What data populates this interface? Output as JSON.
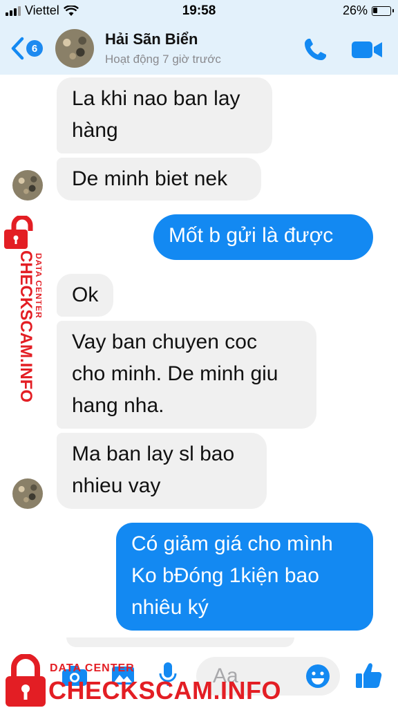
{
  "status_bar": {
    "carrier": "Viettel",
    "time": "19:58",
    "battery": "26%",
    "battery_level": 0.26
  },
  "header": {
    "unread_count": "6",
    "contact_name": "Hải Sãn Biển",
    "contact_status": "Hoạt động 7 giờ trước"
  },
  "messages": [
    {
      "from": "contact",
      "text_lines": [
        "La khi nao ban lay",
        "hàng"
      ]
    },
    {
      "from": "contact",
      "text_lines": [
        "De minh biet nek"
      ]
    },
    {
      "from": "me",
      "text_lines": [
        "Mốt b gửi là  được"
      ]
    },
    {
      "from": "contact",
      "text_lines": [
        "Ok"
      ]
    },
    {
      "from": "contact",
      "text_lines": [
        "Vay ban chuyen coc",
        "cho minh. De minh giu",
        "hang nha."
      ]
    },
    {
      "from": "contact",
      "text_lines": [
        "Ma ban lay sl bao",
        "nhieu vay"
      ]
    },
    {
      "from": "me",
      "text_lines": [
        "Có giảm giá cho mình",
        "Ko bĐóng 1kiện bao",
        "nhiêu ký"
      ]
    }
  ],
  "composer": {
    "placeholder": "Aa"
  },
  "watermark": {
    "side_small": "DATA CENTER",
    "side_large": "CHECKSCAM.INFO",
    "bottom_small": "DATA CENTER",
    "bottom_large": "CHECKSCAM.INFO"
  },
  "icons": {
    "back": "chevron-left-icon",
    "call": "phone-icon",
    "video": "video-camera-icon",
    "camera": "camera-icon",
    "gallery": "image-icon",
    "mic": "microphone-icon",
    "emoji": "smiley-icon",
    "like": "thumbs-up-icon",
    "watermark": "lock-icon"
  },
  "colors": {
    "accent": "#1389f2",
    "incoming_bubble": "#f0f0f0",
    "header_bg": "#e3f1fb",
    "watermark": "#e31e24"
  }
}
